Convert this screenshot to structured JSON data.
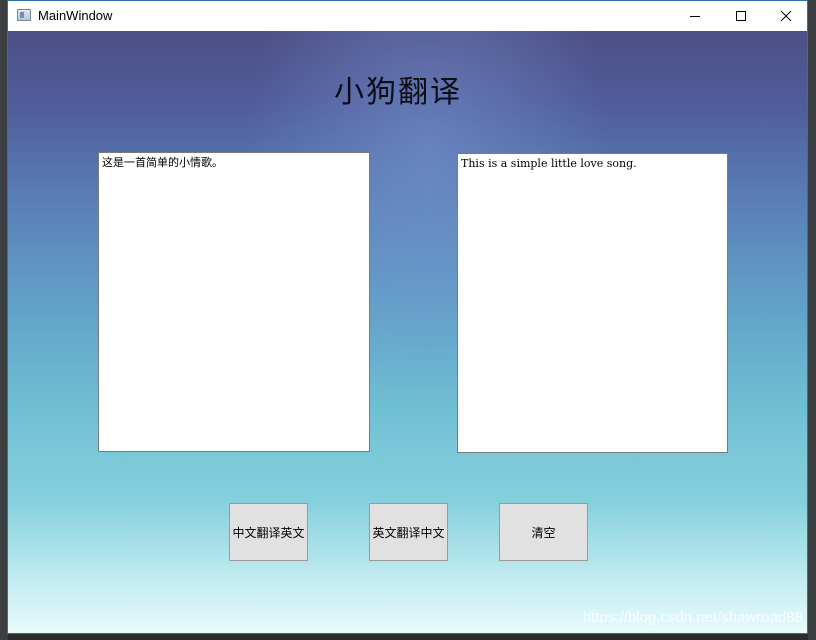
{
  "window": {
    "title": "MainWindow",
    "icon": "app-window-icon",
    "controls": {
      "minimize_icon": "minimize-icon",
      "maximize_icon": "maximize-icon",
      "close_icon": "close-icon"
    }
  },
  "app": {
    "heading": "小狗翻译"
  },
  "input_box": {
    "value": "这是一首简单的小情歌。"
  },
  "output_box": {
    "value": "This is a simple little love song."
  },
  "buttons": {
    "zh_to_en": "中文翻译英文",
    "en_to_zh": "英文翻译中文",
    "clear": "清空"
  },
  "watermark": {
    "url": "https://blog.csdn.net/shawroad88"
  },
  "colors": {
    "title_bar_border": "#2f6fb6",
    "button_bg": "#e1e1e1"
  }
}
